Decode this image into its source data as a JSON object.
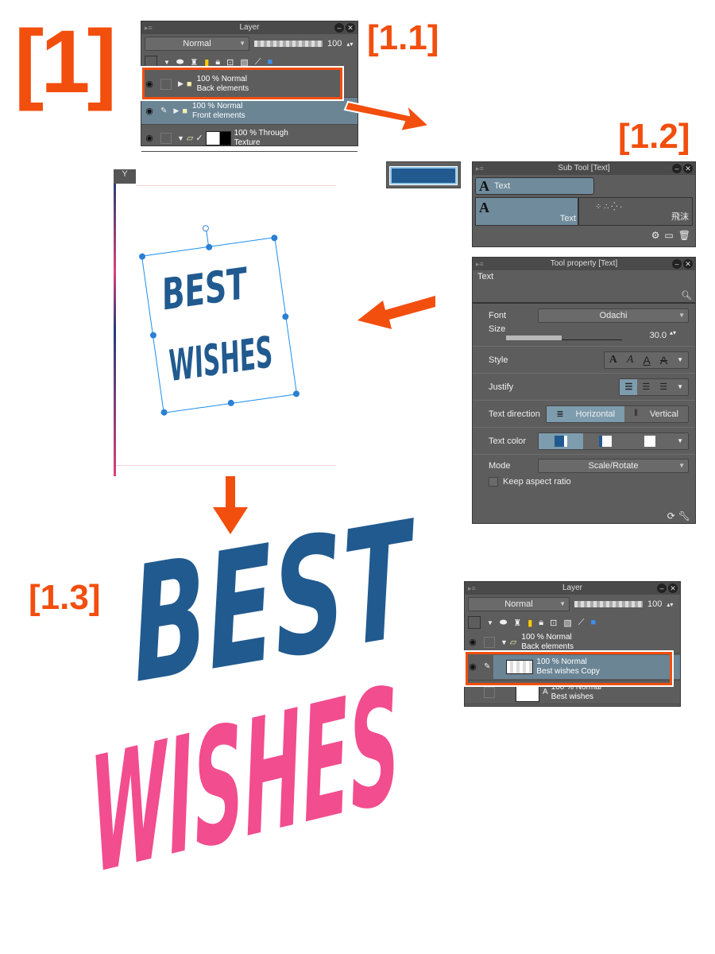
{
  "steps": {
    "s1": "[1]",
    "s11": "[1.1]",
    "s12": "[1.2]",
    "s13": "[1.3]"
  },
  "layer_panel_1": {
    "title": "Layer",
    "blend_mode": "Normal",
    "opacity": "100",
    "layers": [
      {
        "name": "Back elements",
        "meta": "100 % Normal",
        "highlighted": true
      },
      {
        "name": "Front elements",
        "meta": "100 % Normal",
        "selected": true
      },
      {
        "name": "Texture",
        "meta": "100 % Through"
      }
    ]
  },
  "subtool_panel": {
    "title": "Sub Tool [Text]",
    "items": [
      "Text",
      "Text"
    ],
    "brush_label": "飛沫"
  },
  "tool_property": {
    "title": "Tool property [Text]",
    "tool_name": "Text",
    "font_label": "Font",
    "font_value": "Odachi",
    "size_label": "Size",
    "size_value": "30.0",
    "style_label": "Style",
    "justify_label": "Justify",
    "direction_label": "Text direction",
    "direction_options": [
      "Horizontal",
      "Vertical"
    ],
    "color_label": "Text color",
    "mode_label": "Mode",
    "mode_value": "Scale/Rotate",
    "keep_aspect_label": "Keep aspect ratio"
  },
  "canvas": {
    "line1": "BEST",
    "line2": "WISHES"
  },
  "result": {
    "line1": "BEST",
    "line2": "WISHES",
    "color1": "#215a8f",
    "color2": "#f24d8f"
  },
  "layer_panel_2": {
    "title": "Layer",
    "blend_mode": "Normal",
    "opacity": "100",
    "layers": [
      {
        "name": "Back elements",
        "meta": "100 % Normal"
      },
      {
        "name": "Best  wishes Copy",
        "meta": "100 % Normal",
        "selected": true,
        "highlighted": true
      },
      {
        "name": "Best  wishes",
        "meta": "100 % Normal"
      }
    ]
  }
}
